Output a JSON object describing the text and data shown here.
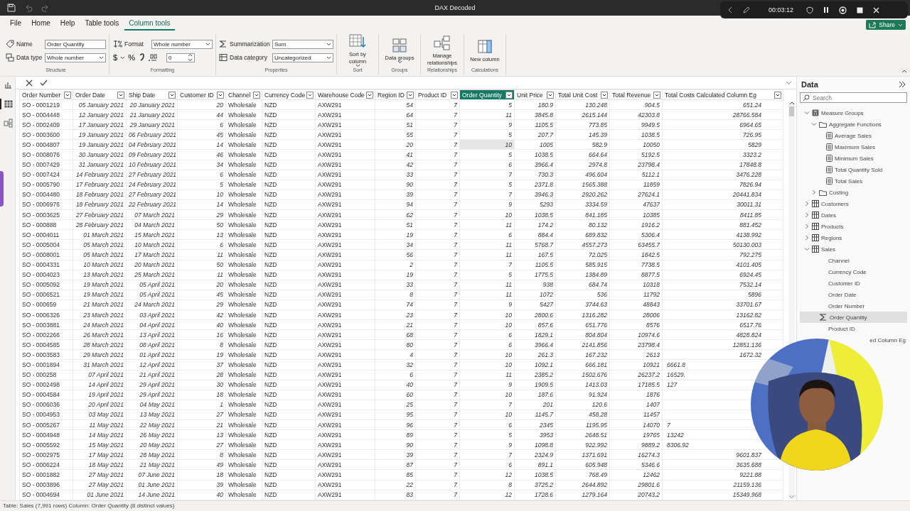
{
  "window": {
    "title": "DAX Decoded"
  },
  "recorder": {
    "time": "00:03:12"
  },
  "ribbon": {
    "tabs": [
      {
        "label": "File",
        "selected": false
      },
      {
        "label": "Home",
        "selected": false
      },
      {
        "label": "Help",
        "selected": false
      },
      {
        "label": "Table tools",
        "selected": false
      },
      {
        "label": "Column tools",
        "selected": true
      }
    ],
    "share": {
      "label": "Share"
    },
    "groups": [
      {
        "kind": "fields",
        "label": "Structure",
        "fields": [
          {
            "label": "Name",
            "value": "Order Quantity",
            "kind": "text"
          },
          {
            "label": "Data type",
            "value": "Whole number",
            "kind": "dropdown"
          }
        ]
      },
      {
        "kind": "formatting",
        "label": "Formatting",
        "fields": [
          {
            "label": "Format",
            "value": "Whole number",
            "kind": "dropdown"
          }
        ],
        "format_buttons": [
          {
            "kind": "currency",
            "label": "$"
          },
          {
            "kind": "caret"
          },
          {
            "kind": "percent",
            "label": "%"
          },
          {
            "kind": "comma"
          },
          {
            "kind": "decimals"
          }
        ],
        "decimal_places": "0"
      },
      {
        "kind": "fields",
        "label": "Properties",
        "fields": [
          {
            "label": "Summarization",
            "value": "Sum",
            "kind": "dropdown"
          },
          {
            "label": "Data category",
            "value": "Uncategorized",
            "kind": "dropdown"
          }
        ]
      },
      {
        "kind": "button",
        "label": "Sort",
        "button": {
          "label": "Sort by column",
          "kind": "sort",
          "dropdown": true
        }
      },
      {
        "kind": "button",
        "label": "Groups",
        "button": {
          "label": "Data groups",
          "kind": "groups",
          "dropdown": true
        }
      },
      {
        "kind": "button",
        "label": "Relationships",
        "button": {
          "label": "Manage relationships",
          "kind": "relationships",
          "dropdown": false
        }
      },
      {
        "kind": "button",
        "label": "Calculations",
        "button": {
          "label": "New column",
          "kind": "newcolumn",
          "dropdown": false
        }
      }
    ]
  },
  "views": [
    {
      "kind": "report",
      "selected": false
    },
    {
      "kind": "table",
      "selected": true
    },
    {
      "kind": "model",
      "selected": false
    }
  ],
  "table": {
    "columns": [
      {
        "label": "Order Number",
        "kind": "text",
        "selected": false
      },
      {
        "label": "Order Date",
        "kind": "date",
        "selected": false
      },
      {
        "label": "Ship Date",
        "kind": "date",
        "selected": false
      },
      {
        "label": "Customer ID",
        "kind": "number",
        "selected": false
      },
      {
        "label": "Channel",
        "kind": "text",
        "selected": false
      },
      {
        "label": "Currency Code",
        "kind": "text",
        "selected": false
      },
      {
        "label": "Warehouse Code",
        "kind": "text",
        "selected": false
      },
      {
        "label": "Region ID",
        "kind": "number",
        "selected": false
      },
      {
        "label": "Product ID",
        "kind": "number",
        "selected": false
      },
      {
        "label": "Order Quantity",
        "kind": "number",
        "selected": true
      },
      {
        "label": "Unit Price",
        "kind": "number",
        "selected": false
      },
      {
        "label": "Total Unit Cost",
        "kind": "number",
        "selected": false
      },
      {
        "label": "Total Revenue",
        "kind": "number",
        "selected": false
      },
      {
        "label": "Total Costs Calculated Column Eg",
        "kind": "number",
        "selected": false
      }
    ],
    "rows": [
      {
        "selected": false,
        "cells": [
          "SO - 0001219",
          "05 January 2021",
          "20 January 2021",
          "20",
          "Wholesale",
          "NZD",
          "AXW291",
          "54",
          "7",
          "5",
          "180.9",
          "130.248",
          "904.5",
          "651.24"
        ]
      },
      {
        "selected": false,
        "cells": [
          "SO - 0004448",
          "12 January 2021",
          "21 January 2021",
          "44",
          "Wholesale",
          "NZD",
          "AXW291",
          "64",
          "7",
          "11",
          "3845.8",
          "2615.144",
          "42303.8",
          "28766.584"
        ]
      },
      {
        "selected": false,
        "cells": [
          "SO - 0002409",
          "17 January 2021",
          "29 January 2021",
          "6",
          "Wholesale",
          "NZD",
          "AXW291",
          "51",
          "7",
          "9",
          "1105.5",
          "773.85",
          "9949.5",
          "6964.65"
        ]
      },
      {
        "selected": false,
        "cells": [
          "SO - 0003600",
          "19 January 2021",
          "06 February 2021",
          "45",
          "Wholesale",
          "NZD",
          "AXW291",
          "55",
          "7",
          "5",
          "207.7",
          "145.39",
          "1038.5",
          "726.95"
        ]
      },
      {
        "selected": true,
        "cells": [
          "SO - 0004807",
          "19 January 2021",
          "04 February 2021",
          "14",
          "Wholesale",
          "NZD",
          "AXW291",
          "20",
          "7",
          "10",
          "1005",
          "582.9",
          "10050",
          "5829"
        ]
      },
      {
        "selected": false,
        "cells": [
          "SO - 0008076",
          "30 January 2021",
          "09 February 2021",
          "46",
          "Wholesale",
          "NZD",
          "AXW291",
          "41",
          "7",
          "5",
          "1038.5",
          "664.64",
          "5192.5",
          "3323.2"
        ]
      },
      {
        "selected": false,
        "cells": [
          "SO - 0007429",
          "31 January 2021",
          "10 February 2021",
          "34",
          "Wholesale",
          "NZD",
          "AXW291",
          "42",
          "7",
          "6",
          "3966.4",
          "2974.8",
          "23798.4",
          "17848.8"
        ]
      },
      {
        "selected": false,
        "cells": [
          "SO - 0007424",
          "14 February 2021",
          "27 February 2021",
          "6",
          "Wholesale",
          "NZD",
          "AXW291",
          "33",
          "7",
          "7",
          "730.3",
          "496.604",
          "5112.1",
          "3476.228"
        ]
      },
      {
        "selected": false,
        "cells": [
          "SO - 0005790",
          "17 February 2021",
          "24 February 2021",
          "5",
          "Wholesale",
          "NZD",
          "AXW291",
          "90",
          "7",
          "5",
          "2371.8",
          "1565.388",
          "11859",
          "7826.94"
        ]
      },
      {
        "selected": false,
        "cells": [
          "SO - 0004480",
          "18 February 2021",
          "27 February 2021",
          "10",
          "Wholesale",
          "NZD",
          "AXW291",
          "39",
          "7",
          "7",
          "3946.3",
          "2920.262",
          "27624.1",
          "20441.834"
        ]
      },
      {
        "selected": false,
        "cells": [
          "SO - 0006976",
          "18 February 2021",
          "22 February 2021",
          "14",
          "Wholesale",
          "NZD",
          "AXW291",
          "94",
          "7",
          "9",
          "5293",
          "3334.59",
          "47637",
          "30011.31"
        ]
      },
      {
        "selected": false,
        "cells": [
          "SO - 0003625",
          "27 February 2021",
          "07 March 2021",
          "29",
          "Wholesale",
          "NZD",
          "AXW291",
          "62",
          "7",
          "10",
          "1038.5",
          "841.185",
          "10385",
          "8411.85"
        ]
      },
      {
        "selected": false,
        "cells": [
          "SO - 000888",
          "28 February 2021",
          "04 March 2021",
          "50",
          "Wholesale",
          "NZD",
          "AXW291",
          "51",
          "7",
          "11",
          "174.2",
          "80.132",
          "1916.2",
          "881.452"
        ]
      },
      {
        "selected": false,
        "cells": [
          "SO - 0004011",
          "01 March 2021",
          "15 March 2021",
          "13",
          "Wholesale",
          "NZD",
          "AXW291",
          "19",
          "7",
          "6",
          "884.4",
          "689.832",
          "5306.4",
          "4138.992"
        ]
      },
      {
        "selected": false,
        "cells": [
          "SO - 0005004",
          "05 March 2021",
          "10 March 2021",
          "6",
          "Wholesale",
          "NZD",
          "AXW291",
          "34",
          "7",
          "11",
          "5768.7",
          "4557.273",
          "63455.7",
          "50130.003"
        ]
      },
      {
        "selected": false,
        "cells": [
          "SO - 0008001",
          "05 March 2021",
          "17 March 2021",
          "11",
          "Wholesale",
          "NZD",
          "AXW291",
          "56",
          "7",
          "11",
          "167.5",
          "72.025",
          "1842.5",
          "792.275"
        ]
      },
      {
        "selected": false,
        "cells": [
          "SO - 0004331",
          "10 March 2021",
          "20 March 2021",
          "50",
          "Wholesale",
          "NZD",
          "AXW291",
          "2",
          "7",
          "7",
          "1105.5",
          "585.915",
          "7738.5",
          "4101.405"
        ]
      },
      {
        "selected": false,
        "cells": [
          "SO - 0004023",
          "13 March 2021",
          "25 March 2021",
          "11",
          "Wholesale",
          "NZD",
          "AXW291",
          "19",
          "7",
          "5",
          "1775.5",
          "1384.89",
          "8877.5",
          "6924.45"
        ]
      },
      {
        "selected": false,
        "cells": [
          "SO - 0005092",
          "19 March 2021",
          "05 April 2021",
          "20",
          "Wholesale",
          "NZD",
          "AXW291",
          "33",
          "7",
          "11",
          "938",
          "684.74",
          "10318",
          "7532.14"
        ]
      },
      {
        "selected": false,
        "cells": [
          "SO - 0006521",
          "19 March 2021",
          "05 April 2021",
          "45",
          "Wholesale",
          "NZD",
          "AXW291",
          "8",
          "7",
          "11",
          "1072",
          "536",
          "11792",
          "5896"
        ]
      },
      {
        "selected": false,
        "cells": [
          "SO - 000659",
          "21 March 2021",
          "24 March 2021",
          "29",
          "Wholesale",
          "NZD",
          "AXW291",
          "74",
          "7",
          "9",
          "5427",
          "3744.63",
          "48843",
          "33701.67"
        ]
      },
      {
        "selected": false,
        "cells": [
          "SO - 0006326",
          "23 March 2021",
          "03 April 2021",
          "42",
          "Wholesale",
          "NZD",
          "AXW291",
          "23",
          "7",
          "10",
          "2800.6",
          "1316.282",
          "28006",
          "13162.82"
        ]
      },
      {
        "selected": false,
        "cells": [
          "SO - 0003881",
          "24 March 2021",
          "04 April 2021",
          "40",
          "Wholesale",
          "NZD",
          "AXW291",
          "21",
          "7",
          "10",
          "857.6",
          "651.776",
          "8576",
          "6517.76"
        ]
      },
      {
        "selected": false,
        "cells": [
          "SO - 0002266",
          "26 March 2021",
          "13 April 2021",
          "16",
          "Wholesale",
          "NZD",
          "AXW291",
          "68",
          "7",
          "6",
          "1829.1",
          "804.804",
          "10974.6",
          "4828.824"
        ]
      },
      {
        "selected": false,
        "cells": [
          "SO - 0004585",
          "28 March 2021",
          "08 April 2021",
          "8",
          "Wholesale",
          "NZD",
          "AXW291",
          "80",
          "7",
          "6",
          "3966.4",
          "2141.856",
          "23798.4",
          "12851.136"
        ]
      },
      {
        "selected": false,
        "cells": [
          "SO - 0003583",
          "29 March 2021",
          "01 April 2021",
          "19",
          "Wholesale",
          "NZD",
          "AXW291",
          "4",
          "7",
          "10",
          "261.3",
          "167.232",
          "2613",
          "1672.32"
        ]
      },
      {
        "selected": false,
        "cells": [
          "SO - 0001894",
          "31 March 2021",
          "12 April 2021",
          "37",
          "Wholesale",
          "NZD",
          "AXW291",
          "32",
          "7",
          "10",
          "1092.1",
          "666.181",
          "10921",
          {
            "text": "6661.8",
            "covered": true
          }
        ]
      },
      {
        "selected": false,
        "cells": [
          "SO - 000258",
          "07 April 2021",
          "21 April 2021",
          "28",
          "Wholesale",
          "NZD",
          "AXW291",
          "6",
          "7",
          "11",
          "2385.2",
          "1502.676",
          "26237.2",
          {
            "text": "16529.",
            "covered": true
          }
        ]
      },
      {
        "selected": false,
        "cells": [
          "SO - 0002498",
          "14 April 2021",
          "29 April 2021",
          "30",
          "Wholesale",
          "NZD",
          "AXW291",
          "40",
          "7",
          "9",
          "1909.5",
          "1413.03",
          "17185.5",
          {
            "text": "127",
            "covered": true
          }
        ]
      },
      {
        "selected": false,
        "cells": [
          "SO - 0004584",
          "19 April 2021",
          "29 April 2021",
          "18",
          "Wholesale",
          "NZD",
          "AXW291",
          "60",
          "7",
          "10",
          "187.6",
          "91.924",
          "1876",
          null
        ]
      },
      {
        "selected": false,
        "cells": [
          "SO - 0006036",
          "20 April 2021",
          "04 May 2021",
          "1",
          "Wholesale",
          "NZD",
          "AXW291",
          "25",
          "7",
          "7",
          "201",
          "120.6",
          "1407",
          null
        ]
      },
      {
        "selected": false,
        "cells": [
          "SO - 0004953",
          "03 May 2021",
          "13 May 2021",
          "27",
          "Wholesale",
          "NZD",
          "AXW291",
          "95",
          "7",
          "10",
          "1145.7",
          "458.28",
          "11457",
          null
        ]
      },
      {
        "selected": false,
        "cells": [
          "SO - 0005267",
          "11 May 2021",
          "22 May 2021",
          "21",
          "Wholesale",
          "NZD",
          "AXW291",
          "96",
          "7",
          "6",
          "2345",
          "1195.95",
          "14070",
          {
            "text": "7",
            "covered": true
          }
        ]
      },
      {
        "selected": false,
        "cells": [
          "SO - 0004948",
          "14 May 2021",
          "26 May 2021",
          "13",
          "Wholesale",
          "NZD",
          "AXW291",
          "89",
          "7",
          "5",
          "3953",
          "2648.51",
          "19765",
          {
            "text": "13242",
            "covered": true
          }
        ]
      },
      {
        "selected": false,
        "cells": [
          "SO - 0005592",
          "15 May 2021",
          "20 May 2021",
          "27",
          "Wholesale",
          "NZD",
          "AXW291",
          "90",
          "7",
          "9",
          "1098.8",
          "922.992",
          "9889.2",
          {
            "text": "8306.92",
            "covered": true
          }
        ]
      },
      {
        "selected": false,
        "cells": [
          "SO - 0002975",
          "17 May 2021",
          "28 May 2021",
          "8",
          "Wholesale",
          "NZD",
          "AXW291",
          "39",
          "7",
          "7",
          "2324.9",
          "1371.691",
          "16274.3",
          "9601.837"
        ]
      },
      {
        "selected": false,
        "cells": [
          "SO - 0006224",
          "18 May 2021",
          "21 May 2021",
          "49",
          "Wholesale",
          "NZD",
          "AXW291",
          "87",
          "7",
          "6",
          "891.1",
          "605.948",
          "5346.6",
          "3635.688"
        ]
      },
      {
        "selected": false,
        "cells": [
          "SO - 0001882",
          "27 May 2021",
          "07 June 2021",
          "18",
          "Wholesale",
          "NZD",
          "AXW291",
          "85",
          "7",
          "12",
          "1038.5",
          "768.49",
          "12462",
          "9221.88"
        ]
      },
      {
        "selected": false,
        "cells": [
          "SO - 0003896",
          "27 May 2021",
          "01 June 2021",
          "39",
          "Wholesale",
          "NZD",
          "AXW291",
          "22",
          "7",
          "8",
          "3725.2",
          "2644.892",
          "29801.6",
          "21159.136"
        ]
      },
      {
        "selected": false,
        "cells": [
          "SO - 0004694",
          "01 June 2021",
          "14 June 2021",
          "40",
          "Wholesale",
          "NZD",
          "AXW291",
          "83",
          "7",
          "12",
          "1728.6",
          "1279.164",
          "20743.2",
          "15349.968"
        ]
      }
    ]
  },
  "sidebar": {
    "title": "Data",
    "search": {
      "placeholder": "Search"
    },
    "tree": [
      {
        "label": "Measure Groups",
        "kind": "group",
        "expanded": true,
        "selected": false,
        "children": [
          {
            "label": "Aggregate Functions",
            "kind": "folder",
            "expanded": true,
            "selected": false,
            "children": [
              {
                "label": "Average Sales",
                "kind": "measure",
                "selected": false
              },
              {
                "label": "Maximum Sales",
                "kind": "measure",
                "selected": false
              },
              {
                "label": "Minimum Sales",
                "kind": "measure",
                "selected": false
              },
              {
                "label": "Total Quantity Sold",
                "kind": "measure",
                "selected": false
              },
              {
                "label": "Total Sales",
                "kind": "measure",
                "selected": false
              }
            ]
          },
          {
            "label": "Costing",
            "kind": "folder",
            "expanded": false,
            "selected": false
          }
        ]
      },
      {
        "label": "Customers",
        "kind": "table",
        "expanded": false,
        "selected": false
      },
      {
        "label": "Dates",
        "kind": "table",
        "expanded": false,
        "selected": false
      },
      {
        "label": "Products",
        "kind": "table",
        "expanded": false,
        "selected": false
      },
      {
        "label": "Regions",
        "kind": "table",
        "expanded": false,
        "selected": false
      },
      {
        "label": "Sales",
        "kind": "table",
        "expanded": true,
        "selected": false,
        "children": [
          {
            "label": "Channel",
            "kind": "field",
            "selected": false
          },
          {
            "label": "Currency Code",
            "kind": "field",
            "selected": false
          },
          {
            "label": "Customer ID",
            "kind": "field",
            "selected": false
          },
          {
            "label": "Order Date",
            "kind": "field",
            "selected": false
          },
          {
            "label": "Order Number",
            "kind": "field",
            "selected": false
          },
          {
            "label": "Order Quantity",
            "kind": "sum-field",
            "selected": true
          },
          {
            "label": "Product ID",
            "kind": "field",
            "selected": false
          },
          {
            "label": "ed Column Eg",
            "kind": "field",
            "selected": false,
            "covered": true
          }
        ]
      }
    ]
  },
  "status_bar": {
    "text": "Table: Sales (7,991 rows) Column: Order Quantity (8 distinct values)"
  }
}
